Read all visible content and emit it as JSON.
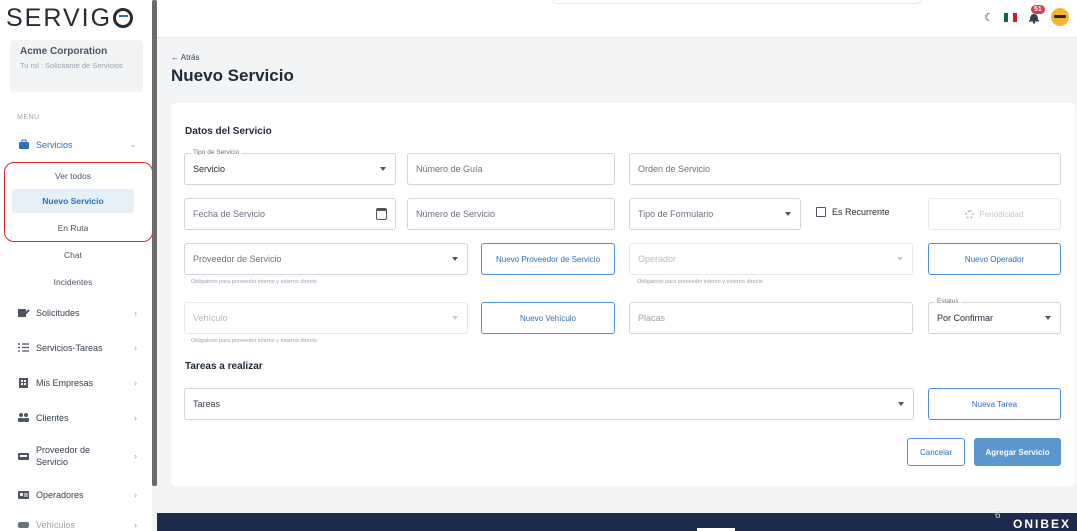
{
  "app": {
    "logo": "SERVIG"
  },
  "company": {
    "name": "Acme Corporation",
    "role": "Tu rol : Solicitante de Servicios"
  },
  "sidebar": {
    "menu_label": "MENÚ",
    "servicios": "Servicios",
    "sub": {
      "ver_todos": "Ver todos",
      "nuevo_servicio": "Nuevo Servicio",
      "en_ruta": "En Ruta",
      "chat": "Chat",
      "incidentes": "Incidentes"
    },
    "items": {
      "solicitudes": "Solicitudes",
      "servicios_tareas": "Servicios-Tareas",
      "mis_empresas": "Mis Empresas",
      "clientes": "Clientes",
      "proveedor": "Proveedor de Servicio",
      "operadores": "Operadores",
      "vehiculos": "Vehículos"
    }
  },
  "topbar": {
    "notifications": "51"
  },
  "header": {
    "back": "← Atrás",
    "title": "Nuevo Servicio"
  },
  "form": {
    "section_datos": "Datos del Servicio",
    "tipo_servicio_label": "Tipo de Servicio",
    "tipo_servicio_value": "Servicio",
    "numero_guia": "Número de Guía",
    "orden_servicio": "Orden de Servicio",
    "fecha_servicio": "Fecha de Servicio",
    "numero_servicio": "Número de Servicio",
    "tipo_formulario": "Tipo de Formulario",
    "es_recurrente": "Es Recurrente",
    "periodicidad": "Periodicidad",
    "proveedor": "Proveedor de Servicio",
    "proveedor_help": "Obligatorio para proveedor interno y externo directo",
    "nuevo_proveedor": "Nuevo Proveedor de Servicio",
    "operador": "Operador",
    "operador_help": "Obligatorio para proveedor interno y externo directo",
    "nuevo_operador": "Nuevo Operador",
    "vehiculo": "Vehículo",
    "vehiculo_help": "Obligatorio para proveedor interno y externo directo",
    "nuevo_vehiculo": "Nuevo Vehículo",
    "placas": "Placas",
    "estatus_label": "Estatus",
    "estatus_value": "Por Confirmar",
    "section_tareas": "Tareas a realizar",
    "tareas": "Tareas",
    "nueva_tarea": "Nueva Tarea",
    "cancelar": "Cancelar",
    "agregar": "Agregar Servicio"
  },
  "footer": {
    "page": "6",
    "brand": "ONIBEX"
  },
  "colors": {
    "accent": "#2e6fb5",
    "primary_button": "#5b96cf",
    "highlight": "#d9252a",
    "footer": "#1d2b4f"
  }
}
